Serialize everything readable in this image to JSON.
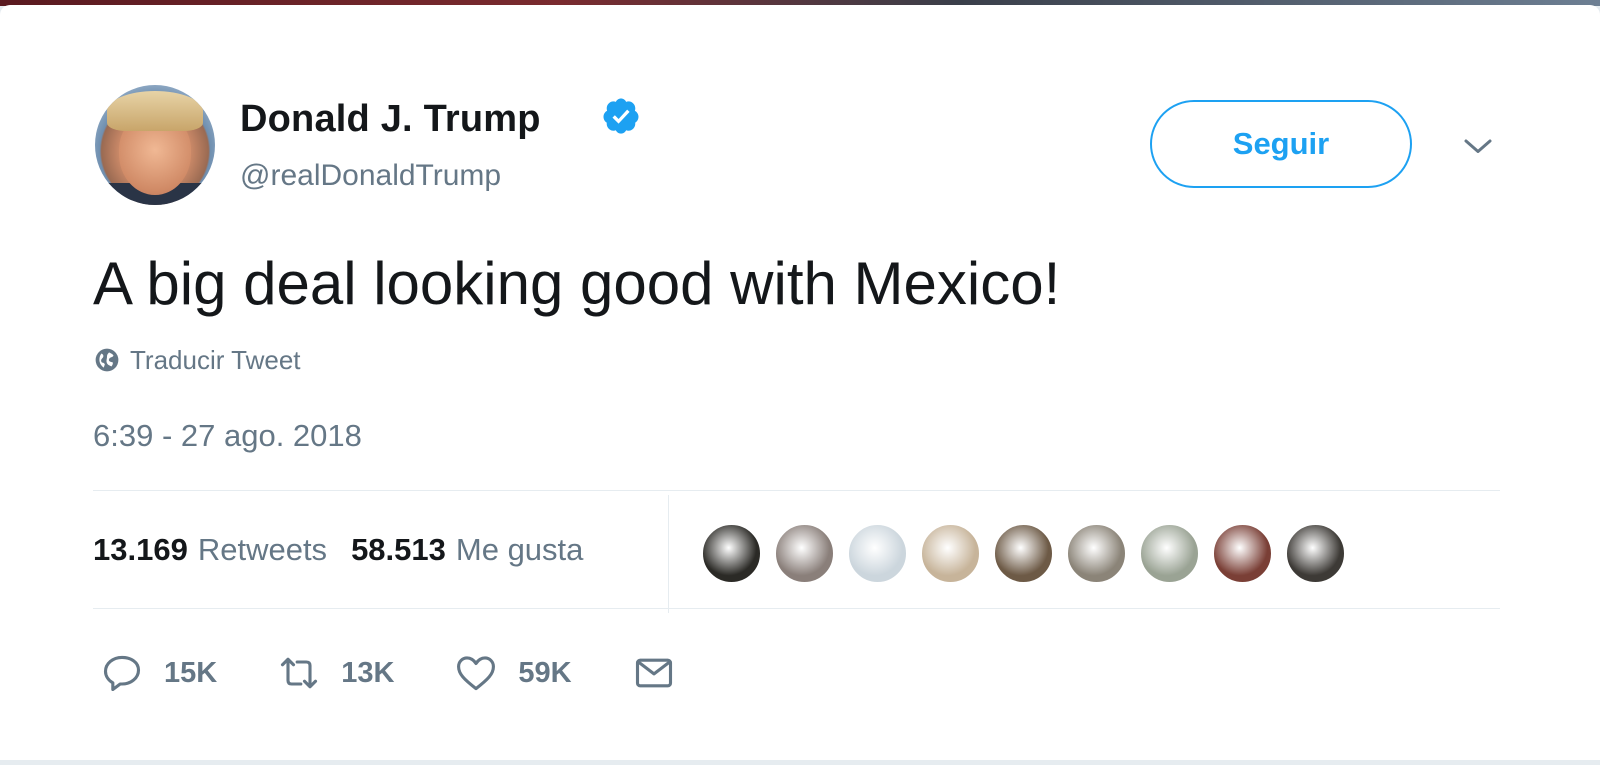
{
  "author": {
    "name": "Donald J. Trump",
    "handle": "@realDonaldTrump",
    "verified": true
  },
  "follow_button": {
    "label": "Seguir"
  },
  "tweet": {
    "text": "A big deal looking good with Mexico!",
    "translate_label": "Traducir Tweet",
    "timestamp": "6:39 - 27 ago. 2018"
  },
  "stats": {
    "retweets_count": "13.169",
    "retweets_label": "Retweets",
    "likes_count": "58.513",
    "likes_label": "Me gusta"
  },
  "likers": [
    {
      "color": "#2b2a26"
    },
    {
      "color": "#8a7f7a"
    },
    {
      "color": "#ccd6dd"
    },
    {
      "color": "#c7b49a"
    },
    {
      "color": "#6d5a46"
    },
    {
      "color": "#8b8478"
    },
    {
      "color": "#9aa394"
    },
    {
      "color": "#7a3f36"
    },
    {
      "color": "#3d3a36"
    }
  ],
  "actions": {
    "reply_count": "15K",
    "retweet_count": "13K",
    "like_count": "59K"
  },
  "colors": {
    "accent": "#1da1f2",
    "muted": "#657786",
    "text": "#14171a"
  }
}
